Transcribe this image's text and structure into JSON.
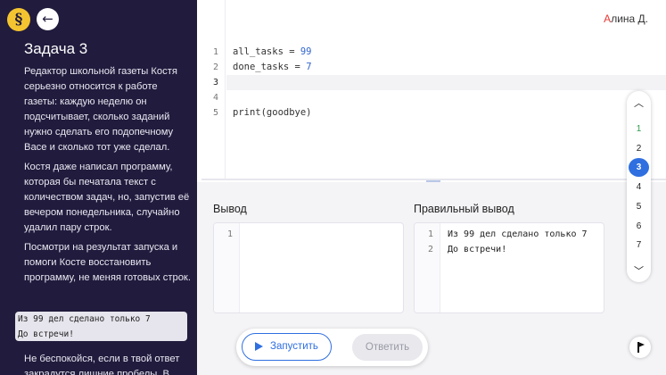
{
  "logo": {
    "glyph": "§"
  },
  "nav": {
    "back_glyph": "←"
  },
  "task": {
    "title": "Задача 3",
    "paragraphs": [
      "Редактор школьной газеты Костя серьезно относится к работе газеты: каждую неделю он подсчитывает, сколько заданий нужно сделать его подопечному Васе и сколько тот уже сделал.",
      "Костя даже написал программу, которая бы печатала текст с количеством задач, но, запустив её вечером понедельника, случайно удалил пару строк.",
      "Посмотри на результат запуска и помоги Косте восстановить программу, не меняя готовых строк."
    ],
    "expected_output": "Из 99 дел сделано только 7\nДо встречи!",
    "footer_text": "Не беспокойся, если в твой ответ закрадутся лишние пробелы. В"
  },
  "user": {
    "first_letter": "А",
    "rest": "лина Д."
  },
  "editor": {
    "lines": [
      {
        "n": "1",
        "code": "all_tasks = ",
        "num": "99"
      },
      {
        "n": "2",
        "code": "done_tasks = ",
        "num": "7"
      },
      {
        "n": "3",
        "code": "",
        "num": ""
      },
      {
        "n": "4",
        "code": "",
        "num": ""
      },
      {
        "n": "5",
        "code": "print(goodbye)",
        "num": ""
      }
    ]
  },
  "picker": {
    "up": "︿",
    "down": "﹀",
    "items": [
      "1",
      "2",
      "3",
      "4",
      "5",
      "6",
      "7"
    ],
    "current": "3",
    "done": "1"
  },
  "output": {
    "label": "Вывод",
    "lines": [
      "1"
    ]
  },
  "correct_output": {
    "label": "Правильный вывод",
    "lines": [
      {
        "n": "1",
        "text": "Из 99 дел сделано только 7"
      },
      {
        "n": "2",
        "text": "До встречи!"
      }
    ]
  },
  "actions": {
    "run": "Запустить",
    "answer": "Ответить"
  }
}
